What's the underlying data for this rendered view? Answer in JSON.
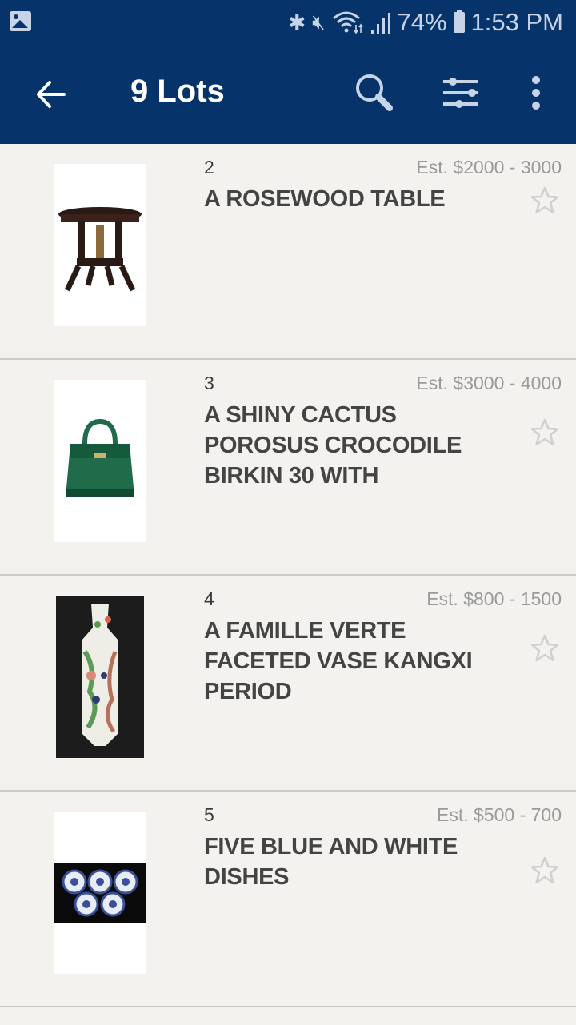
{
  "status_bar": {
    "left_icon": "gallery-icon",
    "icons": [
      "bluetooth-icon",
      "mute-vibrate-icon",
      "wifi-icon",
      "signal-icon"
    ],
    "battery_percent": "74%",
    "battery_icon": "battery-icon",
    "time": "1:53 PM"
  },
  "toolbar": {
    "back_icon": "arrow-left-icon",
    "title": "9 Lots",
    "search_icon": "search-icon",
    "filter_icon": "sliders-icon",
    "more_icon": "more-vertical-icon"
  },
  "lots": [
    {
      "number": "2",
      "estimate": "Est. $2000 - 3000",
      "title": "A ROSEWOOD TABLE",
      "image": "rosewood-table",
      "favorited": false
    },
    {
      "number": "3",
      "estimate": "Est. $3000 - 4000",
      "title": "A SHINY CACTUS POROSUS CROCODILE BIRKIN 30 WITH",
      "image": "green-birkin-bag",
      "favorited": false
    },
    {
      "number": "4",
      "estimate": "Est. $800 - 1500",
      "title": "A FAMILLE VERTE FACETED VASE KANGXI PERIOD",
      "image": "famille-verte-vase",
      "favorited": false
    },
    {
      "number": "5",
      "estimate": "Est. $500 - 700",
      "title": "FIVE BLUE AND WHITE DISHES",
      "image": "blue-white-dishes",
      "favorited": false
    }
  ],
  "colors": {
    "header_bg": "#05336a",
    "list_bg": "#f3f2ee",
    "title_text": "#444444",
    "estimate_text": "#9a9a9a",
    "divider": "#cdcbc6",
    "star": "#cfcfcf"
  }
}
